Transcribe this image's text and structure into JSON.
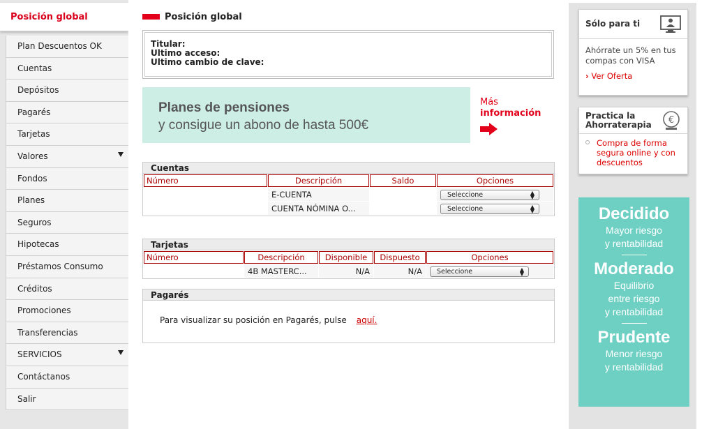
{
  "sidebar": {
    "header": "Posición global",
    "items": [
      {
        "label": "Plan Descuentos OK",
        "arrow": false
      },
      {
        "label": "Cuentas",
        "arrow": false
      },
      {
        "label": "Depósitos",
        "arrow": false
      },
      {
        "label": "Pagarés",
        "arrow": false
      },
      {
        "label": "Tarjetas",
        "arrow": false
      },
      {
        "label": "Valores",
        "arrow": true
      },
      {
        "label": "Fondos",
        "arrow": false
      },
      {
        "label": "Planes",
        "arrow": false
      },
      {
        "label": "Seguros",
        "arrow": false
      },
      {
        "label": "Hipotecas",
        "arrow": false
      },
      {
        "label": "Préstamos Consumo",
        "arrow": false
      },
      {
        "label": "Créditos",
        "arrow": false
      },
      {
        "label": "Promociones",
        "arrow": false
      },
      {
        "label": "Transferencias",
        "arrow": false
      },
      {
        "label": "SERVICIOS",
        "arrow": true
      },
      {
        "label": "Contáctanos",
        "arrow": false
      },
      {
        "label": "Salir",
        "arrow": false
      }
    ]
  },
  "main": {
    "title": "Posición global",
    "info": {
      "titular": "Titular:",
      "ultimo_acceso": "Ultimo acceso:",
      "ultimo_cambio": "Ultimo cambio de clave:"
    },
    "banner": {
      "line1": "Planes de pensiones",
      "line2": "y consigue un abono de hasta 500€",
      "more_1": "Más",
      "more_2": "información"
    },
    "cuentas": {
      "title": "Cuentas",
      "headers": [
        "Número",
        "Descripción",
        "Saldo",
        "Opciones"
      ],
      "rows": [
        {
          "numero": "",
          "descripcion": "E-CUENTA",
          "saldo": "",
          "opcion": "Seleccione"
        },
        {
          "numero": "",
          "descripcion": "CUENTA NÓMINA O...",
          "saldo": "",
          "opcion": "Seleccione"
        }
      ]
    },
    "tarjetas": {
      "title": "Tarjetas",
      "headers": [
        "Número",
        "Descripción",
        "Disponible",
        "Dispuesto",
        "Opciones"
      ],
      "rows": [
        {
          "numero": "",
          "descripcion": "4B MASTERC...",
          "disponible": "N/A",
          "dispuesto": "N/A",
          "opcion": "Seleccione"
        }
      ]
    },
    "pagares": {
      "title": "Pagarés",
      "text": "Para visualizar su posición en Pagarés, pulse",
      "link": "aquí."
    }
  },
  "right": {
    "solo": {
      "title": "Sólo para ti",
      "body": "Ahórrate un 5% en tus compas con VISA",
      "link": "Ver Oferta"
    },
    "ahorro": {
      "title_1": "Practica la",
      "title_2": "Ahorraterapia",
      "body": "Compra de forma segura online y con descuentos"
    },
    "promo": {
      "t1": "Decidido",
      "s1a": "Mayor riesgo",
      "s1b": "y rentabilidad",
      "t2": "Moderado",
      "s2a": "Equilibrio",
      "s2b": "entre riesgo",
      "s2c": "y rentabilidad",
      "t3": "Prudente",
      "s3a": "Menor riesgo",
      "s3b": "y rentabilidad"
    }
  },
  "colors": {
    "brand_red": "#e3001b",
    "promo_teal": "#6ecfc3",
    "banner_mint": "#cdeee5"
  }
}
